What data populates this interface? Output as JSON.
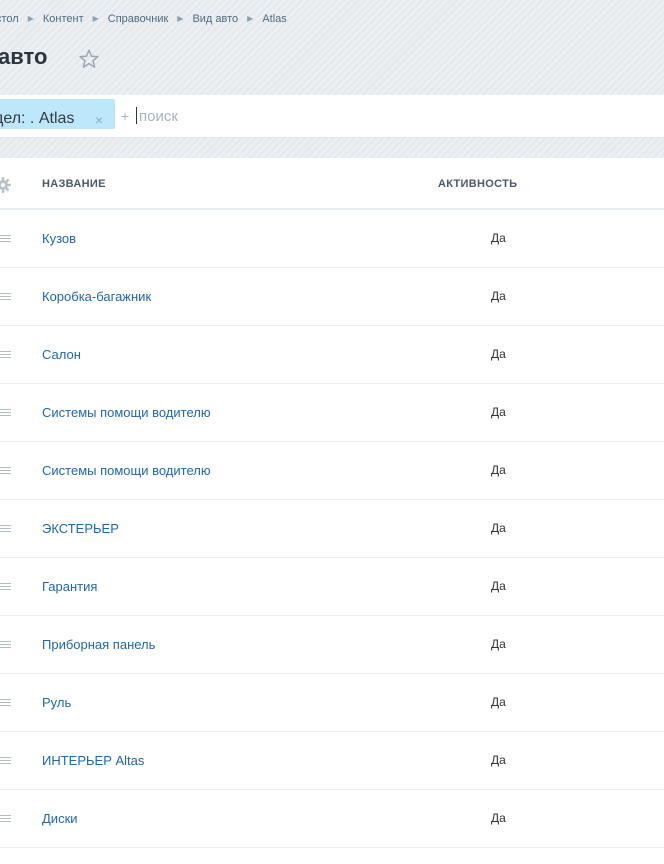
{
  "breadcrumb": {
    "items": [
      "стол",
      "Контент",
      "Справочник",
      "Вид авто",
      "Atlas"
    ]
  },
  "page": {
    "title": "авто"
  },
  "filter": {
    "chip_label": "дел: . Atlas",
    "chip_remove": "×",
    "add": "+",
    "search_placeholder": "поиск"
  },
  "table": {
    "columns": [
      "НАЗВАНИЕ",
      "АКТИВНОСТЬ"
    ],
    "rows": [
      {
        "name": "Кузов",
        "active": "Да"
      },
      {
        "name": "Коробка-багажник",
        "active": "Да"
      },
      {
        "name": "Салон",
        "active": "Да"
      },
      {
        "name": "Системы помощи водителю",
        "active": "Да"
      },
      {
        "name": "Системы помощи водителю",
        "active": "Да"
      },
      {
        "name": "ЭКСТЕРЬЕР",
        "active": "Да"
      },
      {
        "name": "Гарантия",
        "active": "Да"
      },
      {
        "name": "Приборная панель",
        "active": "Да"
      },
      {
        "name": "Руль",
        "active": "Да"
      },
      {
        "name": "ИНТЕРЬЕР Altas",
        "active": "Да"
      },
      {
        "name": "Диски",
        "active": "Да"
      }
    ]
  },
  "colors": {
    "link": "#2067b0",
    "chip": "#bde8fb",
    "header_bg": "#e4eaee"
  }
}
